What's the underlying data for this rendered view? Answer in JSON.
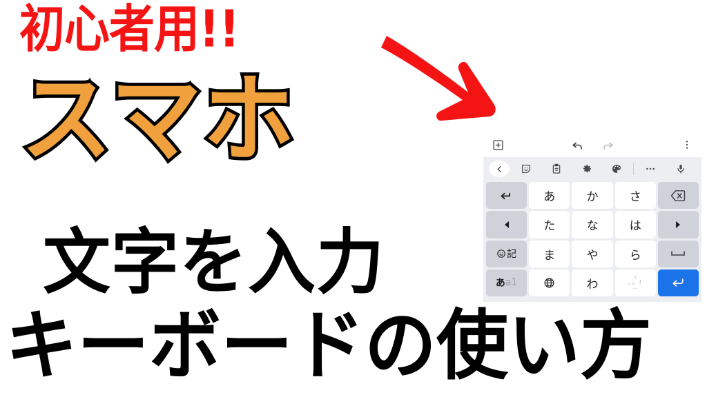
{
  "thumbnail": {
    "headline_red": "初心者用!!",
    "headline_orange": "スマホ",
    "headline_line2": "文字を入力",
    "headline_line3": "キーボードの使い方",
    "colors": {
      "red": "#f41414",
      "orange": "#f0a03c",
      "outline": "#000000",
      "black": "#000000",
      "background": "#ffffff",
      "enter_blue": "#1a73e8",
      "keyboard_panel": "#eceef2",
      "key_white": "#ffffff",
      "key_gray": "#cfd2d8"
    },
    "arrow": {
      "icon": "arrow-down-right-icon",
      "color": "#f41414",
      "direction": "down-right"
    }
  },
  "keyboard": {
    "app_bar": {
      "add_icon": "plus-box-icon",
      "undo_icon": "undo-arrow-icon",
      "redo_icon": "redo-arrow-icon",
      "redo_enabled": false,
      "overflow_icon": "more-vertical-icon"
    },
    "toolbar": [
      {
        "icon": "chevron-left-icon",
        "name": "toolbar-back"
      },
      {
        "icon": "sticker-face-icon",
        "name": "toolbar-sticker"
      },
      {
        "icon": "clipboard-icon",
        "name": "toolbar-clipboard"
      },
      {
        "icon": "gear-icon",
        "name": "toolbar-settings"
      },
      {
        "icon": "palette-icon",
        "name": "toolbar-theme"
      },
      {
        "icon": "more-horizontal-icon",
        "name": "toolbar-more"
      },
      {
        "icon": "microphone-icon",
        "name": "toolbar-voice"
      }
    ],
    "layout_name": "12-key kana (flick) keyboard",
    "rows": [
      [
        {
          "label": "",
          "icon": "undo-conversion-icon",
          "type": "fn",
          "name": "key-undo-conversion"
        },
        {
          "label": "あ",
          "type": "char",
          "name": "key-a"
        },
        {
          "label": "か",
          "type": "char",
          "name": "key-ka"
        },
        {
          "label": "さ",
          "type": "char",
          "name": "key-sa"
        },
        {
          "label": "",
          "icon": "backspace-icon",
          "type": "fn",
          "name": "key-backspace"
        }
      ],
      [
        {
          "label": "",
          "icon": "cursor-left-icon",
          "type": "fn",
          "name": "key-cursor-left"
        },
        {
          "label": "た",
          "type": "char",
          "name": "key-ta"
        },
        {
          "label": "な",
          "type": "char",
          "name": "key-na"
        },
        {
          "label": "は",
          "type": "char",
          "name": "key-ha"
        },
        {
          "label": "",
          "icon": "cursor-right-icon",
          "type": "fn",
          "name": "key-cursor-right"
        }
      ],
      [
        {
          "label": "記",
          "icon": "smiley-icon",
          "type": "fn",
          "name": "key-emoji-symbols"
        },
        {
          "label": "ま",
          "type": "char",
          "name": "key-ma"
        },
        {
          "label": "や",
          "type": "char",
          "name": "key-ya"
        },
        {
          "label": "ら",
          "type": "char",
          "name": "key-ra"
        },
        {
          "label": "",
          "icon": "space-icon",
          "type": "fn",
          "name": "key-space"
        }
      ],
      [
        {
          "label": "あa1",
          "type": "fn",
          "name": "key-input-mode",
          "mode_active": "あ",
          "mode_inactive": "a1"
        },
        {
          "label": "",
          "icon": "globe-icon",
          "type": "char",
          "name": "key-language"
        },
        {
          "label": "わ",
          "type": "char",
          "name": "key-wa"
        },
        {
          "label": "",
          "type": "char",
          "name": "key-punctuation",
          "flick_top": "?",
          "flick_mid": "、。!",
          "flick_bottom": "…"
        },
        {
          "label": "",
          "icon": "enter-icon",
          "type": "enter",
          "name": "key-enter"
        }
      ]
    ]
  }
}
